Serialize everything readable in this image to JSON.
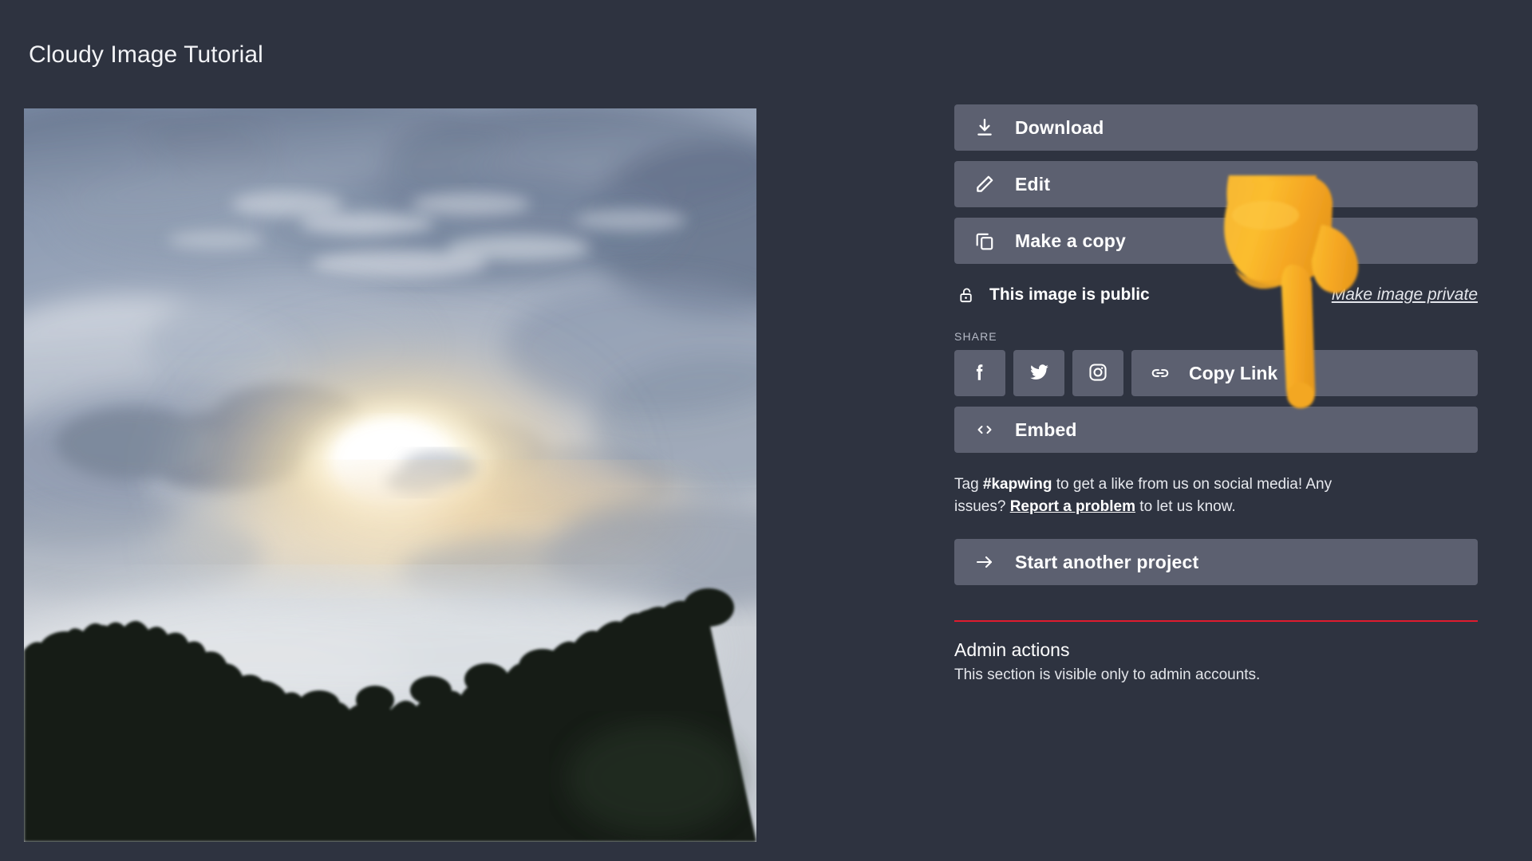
{
  "page": {
    "title": "Cloudy Image Tutorial",
    "background_color": "#2e3340",
    "button_color": "#5c6070",
    "accent_red": "#e01b2e"
  },
  "preview": {
    "alt": "Cloudy sky with sun breaking through clouds above a dark tree line silhouette",
    "icon": "image-preview"
  },
  "actions": [
    {
      "label": "Download",
      "icon": "download-icon"
    },
    {
      "label": "Edit",
      "icon": "pencil-icon"
    },
    {
      "label": "Make a copy",
      "icon": "copy-icon"
    }
  ],
  "visibility": {
    "icon": "unlock-icon",
    "status": "This image is public",
    "toggle_label": "Make image private"
  },
  "share": {
    "section_label": "SHARE",
    "buttons": [
      {
        "label": "Facebook",
        "icon": "facebook-icon"
      },
      {
        "label": "Twitter",
        "icon": "twitter-icon"
      },
      {
        "label": "Instagram",
        "icon": "instagram-icon"
      }
    ],
    "copy_link": {
      "label": "Copy Link",
      "icon": "link-icon"
    },
    "embed": {
      "label": "Embed",
      "icon": "code-brackets-icon"
    }
  },
  "tag_note": {
    "prefix": "Tag ",
    "hashtag": "#kapwing",
    "middle": " to get a like from us on social media! Any issues? ",
    "report_link": "Report a problem",
    "suffix": " to let us know."
  },
  "start_project": {
    "label": "Start another project",
    "icon": "arrow-right-icon"
  },
  "admin": {
    "heading": "Admin actions",
    "subtitle": "This section is visible only to admin accounts."
  },
  "overlay": {
    "icon": "pointing-down-hand-emoji",
    "color": "#f5a623"
  }
}
